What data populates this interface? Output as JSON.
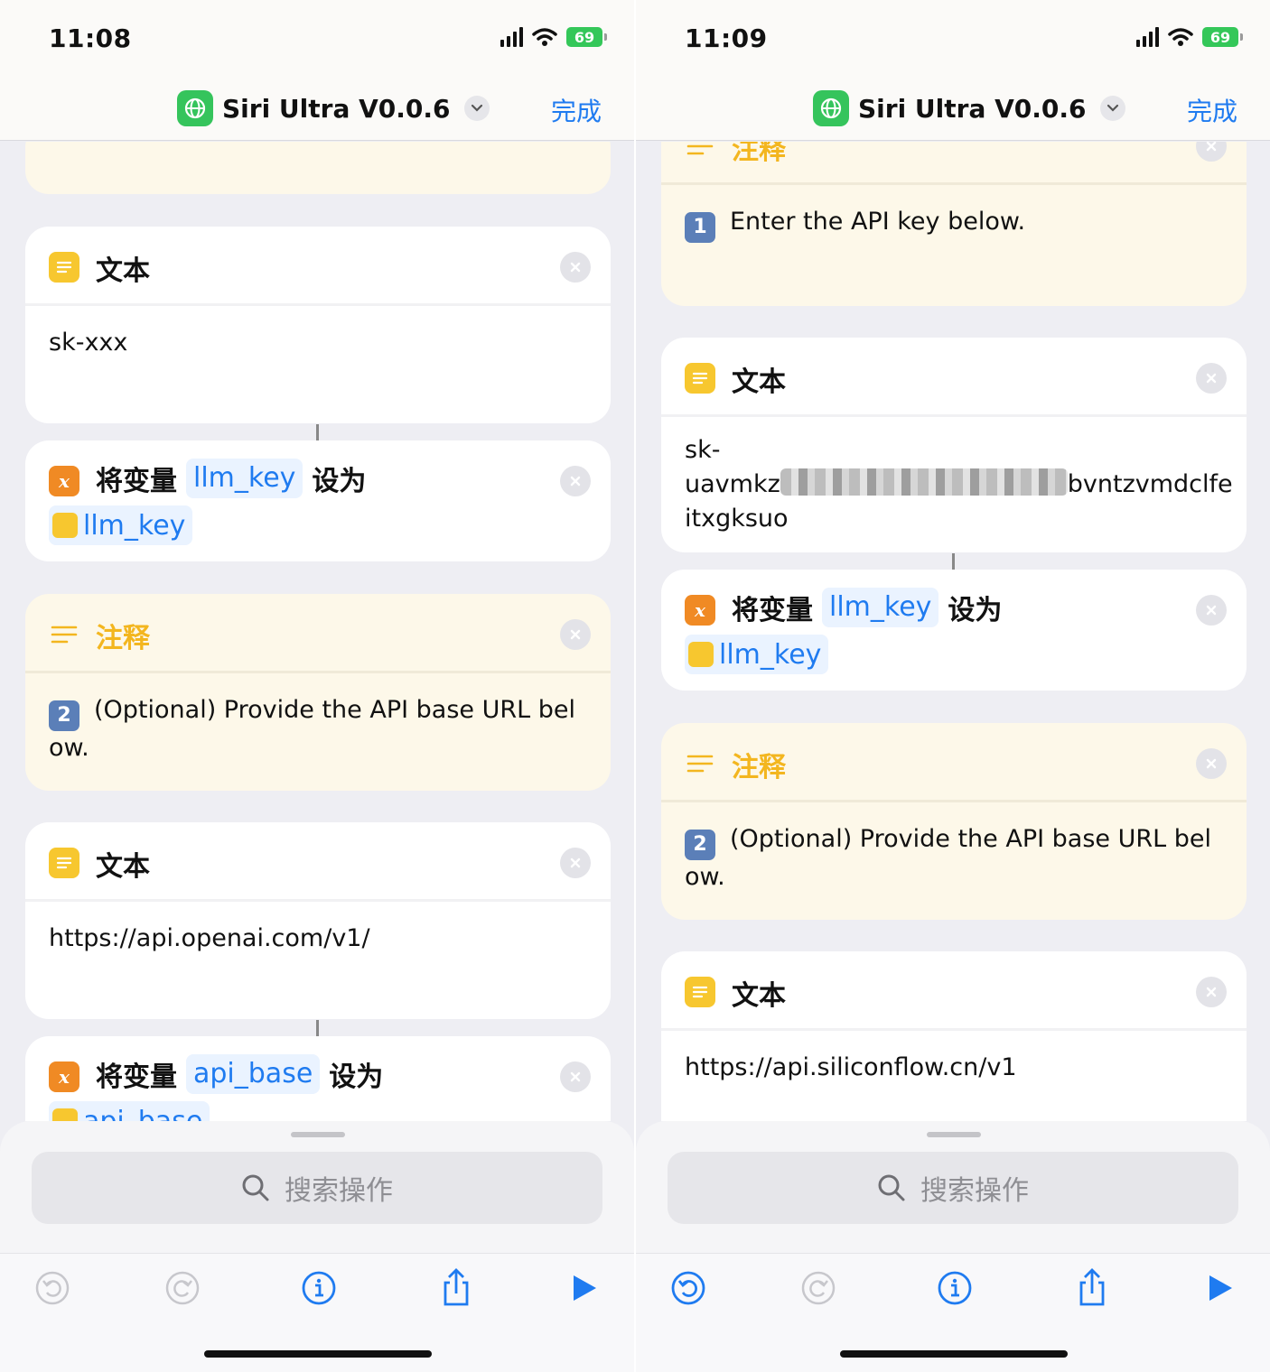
{
  "colors": {
    "accent": "#1f7bf0",
    "note_title": "#f3b61f",
    "text_icon": "#f7c72f",
    "var_icon": "#f08a24",
    "app_icon": "#35c45c"
  },
  "phones": [
    {
      "status": {
        "time": "11:08",
        "battery": "69"
      },
      "nav": {
        "title": "Siri Ultra V0.0.6",
        "done": "完成"
      },
      "cards": {
        "text1": {
          "title": "文本",
          "body": "sk-xxx"
        },
        "setvar1": {
          "prefix": "将变量",
          "variable": "llm_key",
          "suffix": "设为",
          "value": "llm_key"
        },
        "note2": {
          "title": "注释",
          "badge": "2",
          "body": "(Optional) Provide the API base URL below."
        },
        "text2": {
          "title": "文本",
          "body": "https://api.openai.com/v1/"
        },
        "setvar2": {
          "prefix": "将变量",
          "variable": "api_base",
          "suffix": "设为",
          "value": "api_base"
        }
      },
      "search_placeholder": "搜索操作"
    },
    {
      "status": {
        "time": "11:09",
        "battery": "69"
      },
      "nav": {
        "title": "Siri Ultra V0.0.6",
        "done": "完成"
      },
      "cards": {
        "note1": {
          "title": "注释",
          "badge": "1",
          "body": "Enter the API key below."
        },
        "text1": {
          "title": "文本",
          "body_line1": "sk-",
          "body_line2_start": "uavmkz",
          "body_line2_end": "bvntzvmdclfe",
          "body_line3": "itxgksuo"
        },
        "setvar1": {
          "prefix": "将变量",
          "variable": "llm_key",
          "suffix": "设为",
          "value": "llm_key"
        },
        "note2": {
          "title": "注释",
          "badge": "2",
          "body": "(Optional) Provide the API base URL below."
        },
        "text2": {
          "title": "文本",
          "body": "https://api.siliconflow.cn/v1"
        }
      },
      "search_placeholder": "搜索操作"
    }
  ]
}
